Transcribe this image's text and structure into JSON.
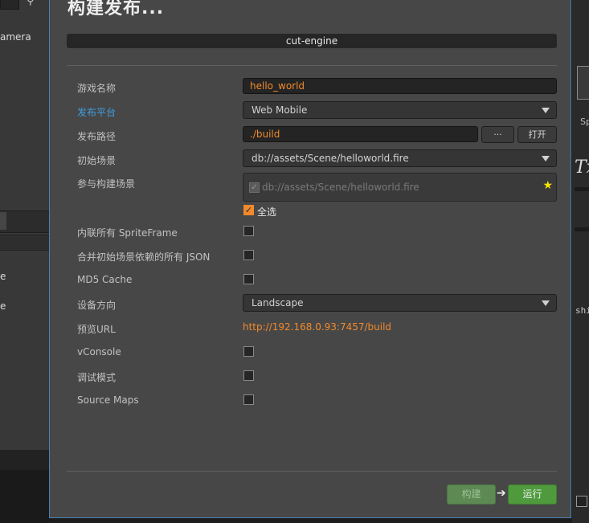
{
  "background": {
    "left_label": "amera",
    "left_item_1": "e",
    "left_item_2": "e",
    "right_label_sp": "Sp",
    "right_label_tx": "Tx",
    "right_label_shi": "shi"
  },
  "dialog": {
    "title": "构建发布...",
    "project_name": "cut-engine",
    "fields": {
      "game_name": {
        "label": "游戏名称",
        "value": "hello_world"
      },
      "platform": {
        "label": "发布平台",
        "value": "Web Mobile"
      },
      "build_path": {
        "label": "发布路径",
        "value": "./build",
        "browse_label": "···",
        "open_label": "打开"
      },
      "start_scene": {
        "label": "初始场景",
        "value": "db://assets/Scene/helloworld.fire"
      },
      "included_scenes": {
        "label": "参与构建场景",
        "items": [
          "db://assets/Scene/helloworld.fire"
        ],
        "select_all_label": "全选"
      },
      "inline_sprite_frame": {
        "label": "内联所有 SpriteFrame",
        "checked": false
      },
      "merge_json": {
        "label": "合并初始场景依赖的所有 JSON",
        "checked": false
      },
      "md5_cache": {
        "label": "MD5 Cache",
        "checked": false
      },
      "orientation": {
        "label": "设备方向",
        "value": "Landscape"
      },
      "preview_url": {
        "label": "预览URL",
        "value": "http://192.168.0.93:7457/build"
      },
      "vconsole": {
        "label": "vConsole",
        "checked": false
      },
      "debug_mode": {
        "label": "调试模式",
        "checked": false
      },
      "source_maps": {
        "label": "Source Maps",
        "checked": false
      }
    },
    "footer": {
      "build_label": "构建",
      "arrow": "➔",
      "run_label": "运行"
    }
  },
  "colors": {
    "accent_orange": "#f08a2c",
    "active_label_blue": "#3f9fe0",
    "run_green": "#4e9a3c",
    "build_green_disabled": "#5c8a52",
    "dialog_border": "#4a7fb8"
  },
  "icons": {
    "dropdown": "chevron-down-icon",
    "star": "star-icon",
    "check": "checkmark-icon",
    "search": "search-icon"
  }
}
